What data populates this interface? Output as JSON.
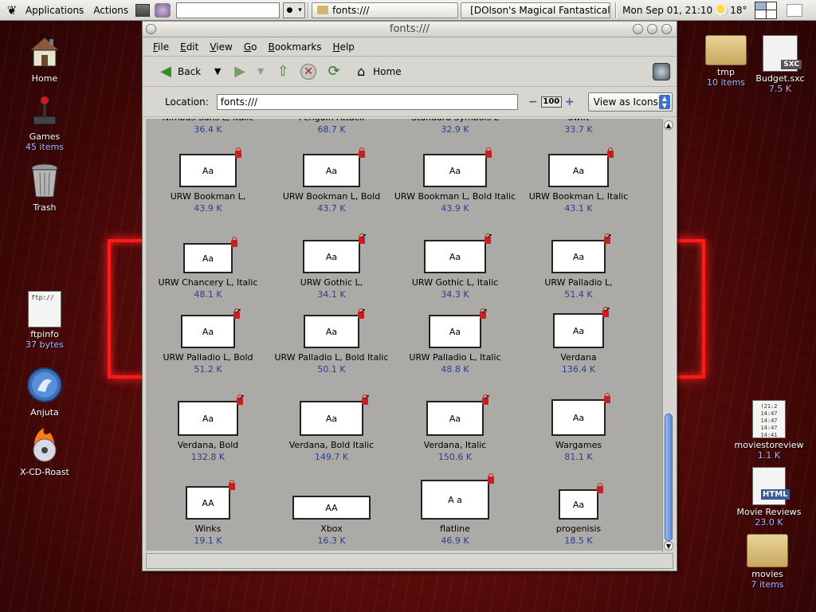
{
  "panel": {
    "applications": "Applications",
    "actions": "Actions",
    "tasks": [
      {
        "label": "fonts:///",
        "color": "#d2b46a"
      },
      {
        "label": "[DOlson's Magical Fantastical",
        "color": "#c04a3a"
      }
    ],
    "clock": "Mon Sep 01, 21:10",
    "temperature": "18°"
  },
  "desktop_left": [
    {
      "label": "Home",
      "sub": ""
    },
    {
      "label": "Games",
      "sub": "45 items"
    },
    {
      "label": "Trash",
      "sub": ""
    },
    {
      "label": "ftpinfo",
      "sub": "37 bytes"
    },
    {
      "label": "Anjuta",
      "sub": ""
    },
    {
      "label": "X-CD-Roast",
      "sub": ""
    }
  ],
  "desktop_right": [
    {
      "label": "tmp",
      "sub": "10 items"
    },
    {
      "label": "Budget.sxc",
      "sub": "7.5 K"
    },
    {
      "label": "moviestoreview",
      "sub": "1.1 K"
    },
    {
      "label": "Movie Reviews",
      "sub": "23.0 K"
    },
    {
      "label": "movies",
      "sub": "7 items"
    }
  ],
  "desktop_text": {
    "ftpinfo_preview": "ftp://",
    "budget_badge": "SXC",
    "html_badge": "HTML",
    "review_preview": "(21:2\n14:47\n14:47\n14:47\n14:41"
  },
  "window": {
    "title": "fonts:///",
    "menu": [
      "File",
      "Edit",
      "View",
      "Go",
      "Bookmarks",
      "Help"
    ],
    "toolbar": {
      "back": "Back",
      "home": "Home"
    },
    "location_label": "Location:",
    "location_value": "fonts:///",
    "zoom": "100",
    "view_as": "View as Icons"
  },
  "partial_row": [
    {
      "name": "Nimbus Sans L, Italic",
      "size": "36.4 K"
    },
    {
      "name": "Penguin Attack",
      "size": "68.7 K"
    },
    {
      "name": "Standard Symbols L",
      "size": "32.9 K"
    },
    {
      "name": "Swift",
      "size": "33.7 K"
    }
  ],
  "fonts": [
    {
      "name": "URW Bookman L,",
      "size": "43.9 K",
      "sample": "Aa"
    },
    {
      "name": "URW Bookman L, Bold",
      "size": "43.7 K",
      "sample": "Aa"
    },
    {
      "name": "URW Bookman L, Bold Italic",
      "size": "43.9 K",
      "sample": "Aa"
    },
    {
      "name": "URW Bookman L, Italic",
      "size": "43.1 K",
      "sample": "Aa"
    },
    {
      "name": "URW Chancery L, Italic",
      "size": "48.1 K",
      "sample": "Aa"
    },
    {
      "name": "URW Gothic L,",
      "size": "34.1 K",
      "sample": "Aa"
    },
    {
      "name": "URW Gothic L, Italic",
      "size": "34.3 K",
      "sample": "Aa"
    },
    {
      "name": "URW Palladio L,",
      "size": "51.4 K",
      "sample": "Aa"
    },
    {
      "name": "URW Palladio L, Bold",
      "size": "51.2 K",
      "sample": "Aa"
    },
    {
      "name": "URW Palladio L, Bold Italic",
      "size": "50.1 K",
      "sample": "Aa"
    },
    {
      "name": "URW Palladio L, Italic",
      "size": "48.8 K",
      "sample": "Aa"
    },
    {
      "name": "Verdana",
      "size": "136.4 K",
      "sample": "Aa"
    },
    {
      "name": "Verdana, Bold",
      "size": "132.8 K",
      "sample": "Aa"
    },
    {
      "name": "Verdana, Bold Italic",
      "size": "149.7 K",
      "sample": "Aa"
    },
    {
      "name": "Verdana, Italic",
      "size": "150.6 K",
      "sample": "Aa"
    },
    {
      "name": "Wargames",
      "size": "81.1 K",
      "sample": "Aa"
    },
    {
      "name": "Winks",
      "size": "19.1 K",
      "sample": "AA"
    },
    {
      "name": "Xbox",
      "size": "16.3 K",
      "sample": "AA"
    },
    {
      "name": "flatline",
      "size": "46.9 K",
      "sample": "A a"
    },
    {
      "name": "progenisis",
      "size": "18.5 K",
      "sample": "Aa"
    }
  ]
}
